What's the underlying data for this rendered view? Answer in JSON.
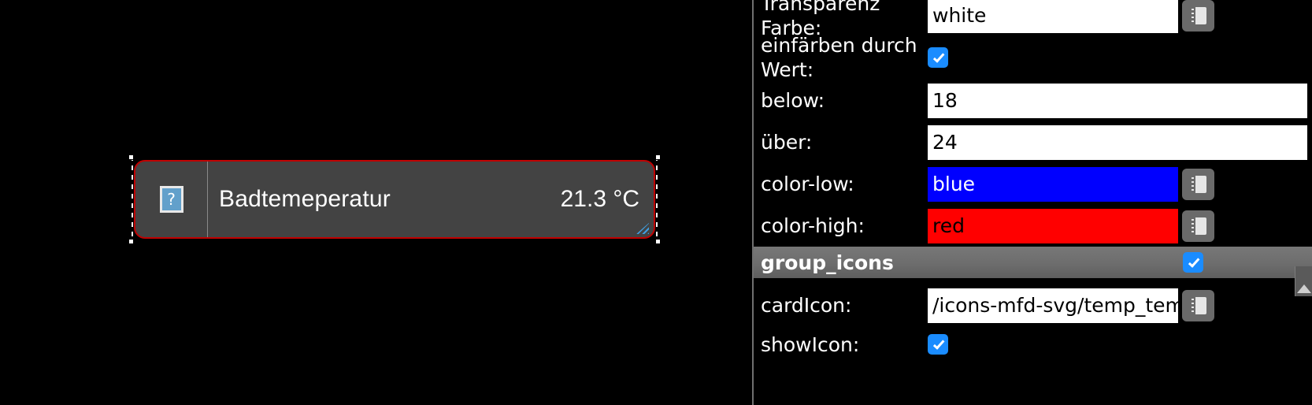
{
  "preview": {
    "card": {
      "icon_name": "broken-image-icon",
      "icon_glyph": "?",
      "title": "Badtemeperatur",
      "value": "21.3 °C",
      "selected": true,
      "selection_color": "#c00000",
      "background": "#434343",
      "text_color": "#ffffff"
    }
  },
  "properties": {
    "rows": [
      {
        "label": "Transparenz Farbe:",
        "type": "text-with-picker",
        "value": "white",
        "picker": "list-picker-icon"
      },
      {
        "label": "einfärben durch Wert:",
        "type": "checkbox",
        "checked": true
      },
      {
        "label": "below:",
        "type": "text",
        "value": "18"
      },
      {
        "label": "über:",
        "type": "text",
        "value": "24"
      },
      {
        "label": "color-low:",
        "type": "color-with-picker",
        "value": "blue",
        "swatch": "#0000ff",
        "picker": "list-picker-icon"
      },
      {
        "label": "color-high:",
        "type": "color-with-picker",
        "value": "red",
        "swatch": "#ff0000",
        "picker": "list-picker-icon"
      }
    ],
    "group": {
      "title": "group_icons",
      "checked": true,
      "rows": [
        {
          "label": "cardIcon:",
          "type": "text-with-picker",
          "value": "/icons-mfd-svg/temp_tem",
          "picker": "list-picker-icon"
        },
        {
          "label": "showIcon:",
          "type": "checkbox",
          "checked": true
        }
      ]
    },
    "scrollbar": {
      "up_arrow": "scroll-up-arrow"
    }
  }
}
